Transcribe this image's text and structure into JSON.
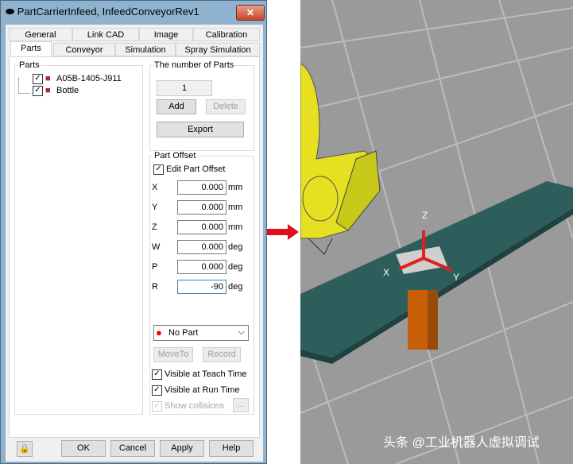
{
  "window": {
    "title": "PartCarrierInfeed, InfeedConveyorRev1",
    "close_label": "✕"
  },
  "tabs_row1": [
    "General",
    "Link CAD",
    "Image",
    "Calibration"
  ],
  "tabs_row2": [
    "Parts",
    "Conveyor",
    "Simulation",
    "Spray Simulation"
  ],
  "parts": {
    "label": "Parts",
    "items": [
      {
        "name": "A05B-1405-J911",
        "checked": true
      },
      {
        "name": "Bottle",
        "checked": true
      }
    ]
  },
  "number": {
    "label": "The number of Parts",
    "value": "1",
    "add": "Add",
    "delete": "Delete",
    "export": "Export"
  },
  "offset": {
    "label": "Part Offset",
    "edit_label": "Edit Part Offset",
    "fields": [
      {
        "label": "X",
        "value": "0.000",
        "unit": "mm"
      },
      {
        "label": "Y",
        "value": "0.000",
        "unit": "mm"
      },
      {
        "label": "Z",
        "value": "0.000",
        "unit": "mm"
      },
      {
        "label": "W",
        "value": "0.000",
        "unit": "deg"
      },
      {
        "label": "P",
        "value": "0.000",
        "unit": "deg"
      },
      {
        "label": "R",
        "value": "-90",
        "unit": "deg"
      }
    ]
  },
  "part_select": "No Part",
  "moveto": "MoveTo",
  "record": "Record",
  "visible_teach": "Visible at Teach Time",
  "visible_run": "Visible at Run Time",
  "show_collisions": "Show collisions",
  "ellipsis": "...",
  "footer": {
    "ok": "OK",
    "cancel": "Cancel",
    "apply": "Apply",
    "help": "Help"
  },
  "scene": {
    "axis_x": "X",
    "axis_y": "Y",
    "axis_z": "Z",
    "watermark": "头条 @工业机器人虚拟调试"
  },
  "colors": {
    "conveyor": "#2e5e5c",
    "post": "#c8600a",
    "robot": "#e6e020",
    "axis": "#e02020",
    "floor": "#9a9a9a"
  }
}
